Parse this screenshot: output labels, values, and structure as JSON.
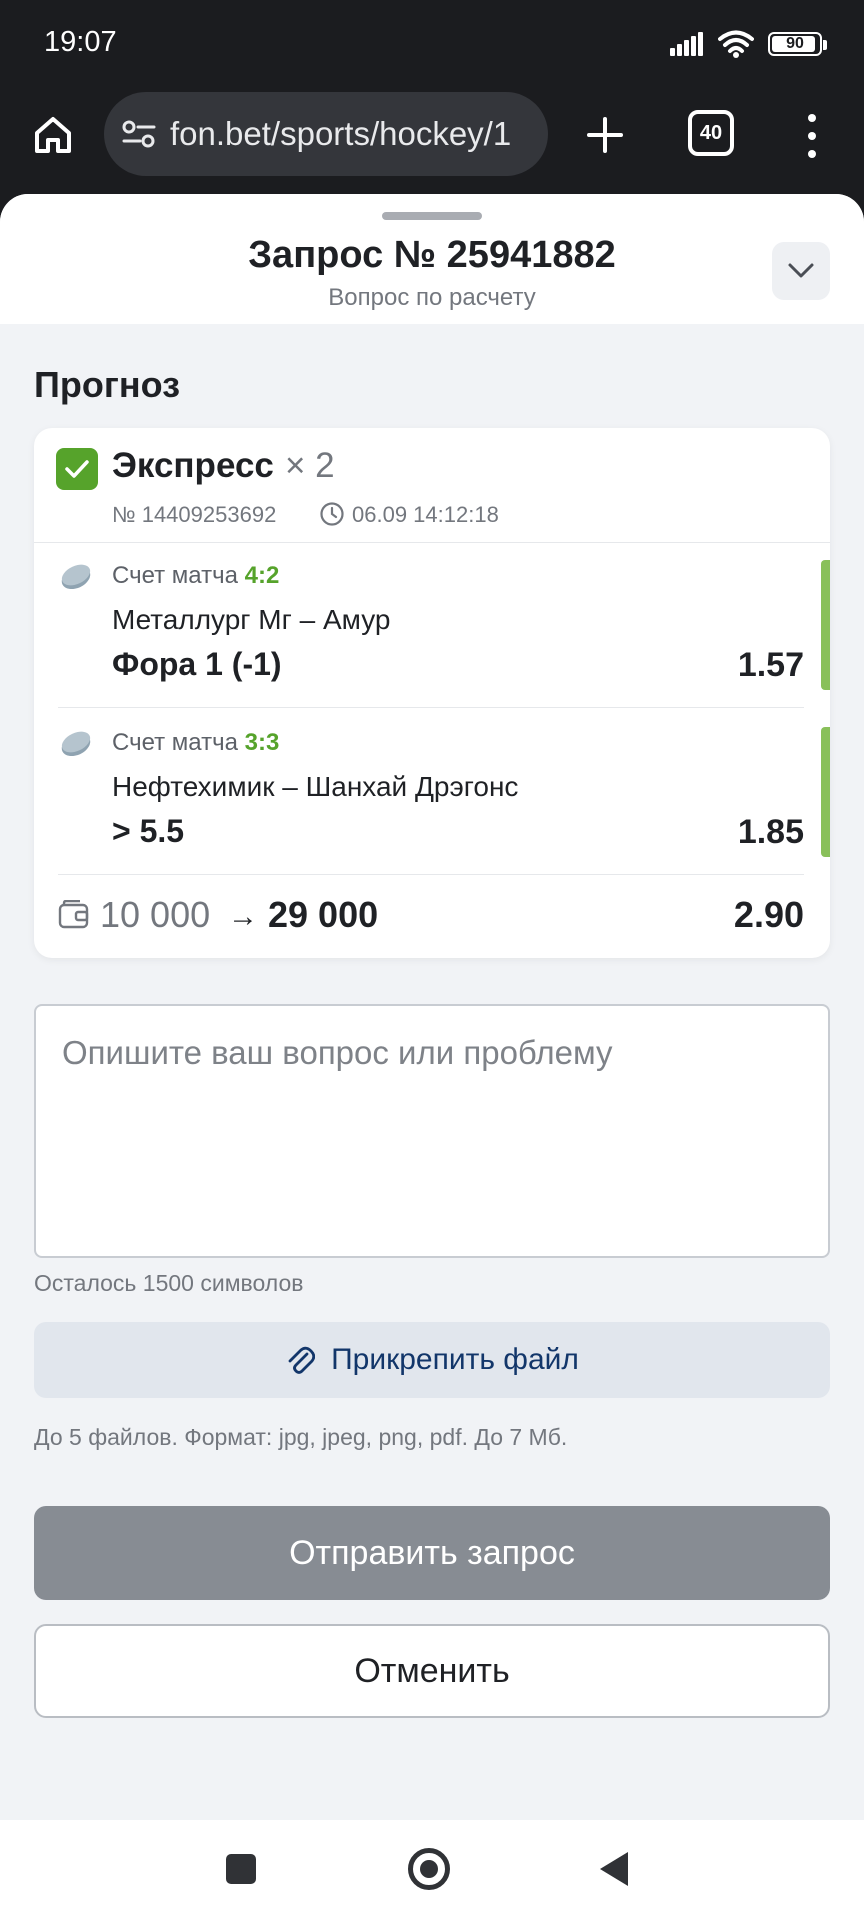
{
  "status_bar": {
    "time": "19:07",
    "battery": "90"
  },
  "browser": {
    "url": "fon.bet/sports/hockey/1",
    "tab_count": "40"
  },
  "sheet": {
    "title": "Запрос № 25941882",
    "subtitle": "Вопрос по расчету"
  },
  "prognoz": {
    "section_title": "Прогноз",
    "bet_type": "Экспресс",
    "multiplier": "× 2",
    "bet_number": "№ 14409253692",
    "datetime": "06.09 14:12:18",
    "events": [
      {
        "score_label": "Счет матча",
        "score": "4:2",
        "teams": "Металлург Мг – Амур",
        "market": "Фора 1 (-1)",
        "odds": "1.57"
      },
      {
        "score_label": "Счет матча",
        "score": "3:3",
        "teams": "Нефтехимик – Шанхай Дрэгонс",
        "market": "> 5.5",
        "odds": "1.85"
      }
    ],
    "stake": "10 000",
    "arrow": "→",
    "payout": "29 000",
    "total_odds": "2.90"
  },
  "form": {
    "question_placeholder": "Опишите ваш вопрос или проблему",
    "char_count": "Осталось 1500 символов",
    "attach_label": "Прикрепить файл",
    "attach_hint": "До 5 файлов. Формат: jpg, jpeg, png, pdf. До 7 Мб.",
    "submit_label": "Отправить запрос",
    "cancel_label": "Отменить"
  },
  "colors": {
    "accent_green": "#56a32b",
    "status_bar_green": "#89c05a",
    "attach_text": "#12366a",
    "submit_disabled": "#878c93"
  }
}
